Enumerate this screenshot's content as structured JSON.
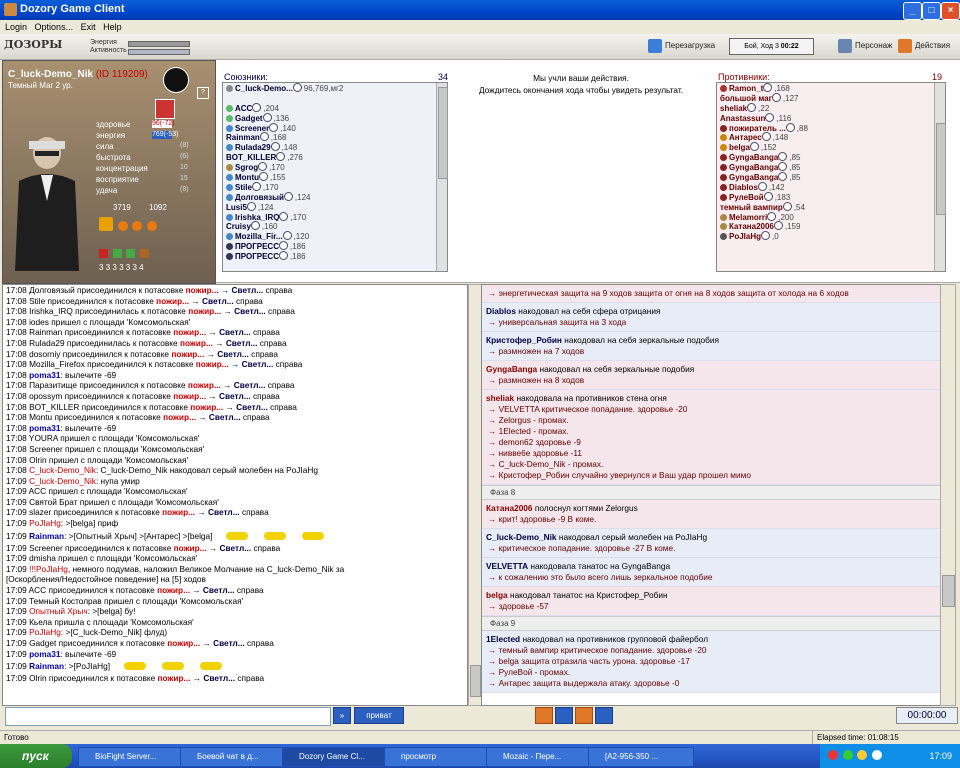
{
  "window": {
    "title": "Dozory Game Client"
  },
  "menu": [
    "Login",
    "Options...",
    "Exit",
    "Help"
  ],
  "toolbar": {
    "logo": "ДОЗОРЫ",
    "energy_label": "Энергия",
    "activity_label": "Активность",
    "reload_label": "Перезагрузка",
    "turn_label": "Бой, Ход 3",
    "turn_time": "00:22",
    "character_label": "Персонаж",
    "actions_label": "Действия"
  },
  "character": {
    "name": "C_luck-Demo_Nik",
    "id": "(ID 119209)",
    "rank": "Темный Маг 2 ур.",
    "stats": [
      {
        "label": "здоровье",
        "value": "96(-72)"
      },
      {
        "label": "энергия",
        "value": "769(-53)"
      },
      {
        "label": "сила",
        "value": "(8)"
      },
      {
        "label": "быстрота",
        "value": "(6)"
      },
      {
        "label": "концентрация",
        "value": "10"
      },
      {
        "label": "восприятие",
        "value": "15"
      },
      {
        "label": "удача",
        "value": "(8)"
      }
    ],
    "money1": "3719",
    "money2": "1092",
    "slots": [
      "3",
      "3",
      "3",
      "3",
      "3",
      "3",
      "4"
    ]
  },
  "allies": {
    "title": "Союзники:",
    "count": "34",
    "rows": [
      {
        "name": "C_luck-Demo...",
        "info": "96,769,мг2",
        "color": "#888"
      },
      {
        "name": "",
        "info": "",
        "color": ""
      },
      {
        "name": "ACC",
        "info": ",204",
        "color": "#5b6"
      },
      {
        "name": "Gadget",
        "info": ",136",
        "color": "#5b6"
      },
      {
        "name": "Screener",
        "info": ",140",
        "color": "#48c"
      },
      {
        "name": "Rainman",
        "info": ",168",
        "color": ""
      },
      {
        "name": "Rulada29",
        "info": ",148",
        "color": "#48c"
      },
      {
        "name": "BOT_KILLER",
        "info": ",276",
        "color": ""
      },
      {
        "name": "Sgrog",
        "info": ",170",
        "color": "#a84"
      },
      {
        "name": "Montu",
        "info": ",155",
        "color": "#48c"
      },
      {
        "name": "Stile",
        "info": ",170",
        "color": "#48c"
      },
      {
        "name": "Долговязый",
        "info": ",124",
        "color": "#48c"
      },
      {
        "name": "Lusi5",
        "info": ",124",
        "color": ""
      },
      {
        "name": "Irishka_IRQ",
        "info": ",170",
        "color": "#48c"
      },
      {
        "name": "Cruisy",
        "info": ",160",
        "color": ""
      },
      {
        "name": "Mozilla_Fir...",
        "info": ",120",
        "color": "#48c"
      },
      {
        "name": "ПРОГРЕСС",
        "info": ",186",
        "color": "#335"
      },
      {
        "name": "ПРОГРЕСС",
        "info": ",186",
        "color": "#335"
      }
    ]
  },
  "center_message": {
    "line1": "Мы учли ваши действия.",
    "line2": "Дождитесь окончания хода чтобы увидеть результат."
  },
  "enemies": {
    "title": "Противники:",
    "count": "19",
    "rows": [
      {
        "name": "Ramon_t",
        "info": ",168",
        "color": "#a33"
      },
      {
        "name": "большой маг",
        "info": ",127",
        "color": ""
      },
      {
        "name": "sheliak",
        "info": ",22",
        "color": ""
      },
      {
        "name": "Anastassun",
        "info": ",116",
        "color": ""
      },
      {
        "name": "пожиратель ...",
        "info": ",88",
        "color": "#822"
      },
      {
        "name": "Антарес",
        "info": ",148",
        "color": "#c80"
      },
      {
        "name": "belga",
        "info": ",152",
        "color": "#c80"
      },
      {
        "name": "GyngaBanga",
        "info": ",85",
        "color": "#822"
      },
      {
        "name": "GyngaBanga",
        "info": ",85",
        "color": "#822"
      },
      {
        "name": "GyngaBanga",
        "info": ",85",
        "color": "#822"
      },
      {
        "name": "Diablos",
        "info": ",142",
        "color": "#822"
      },
      {
        "name": "РулеВой",
        "info": ",183",
        "color": "#822"
      },
      {
        "name": "темный вампир",
        "info": ",54",
        "color": ""
      },
      {
        "name": "Melamorri",
        "info": ",200",
        "color": "#a84"
      },
      {
        "name": "Катана2006",
        "info": ",159",
        "color": "#a84"
      },
      {
        "name": "PoJIaHg",
        "info": ",0",
        "color": "#555"
      }
    ]
  },
  "chat": [
    {
      "t": "17:08",
      "txt": "Долговязый присоединился к потасовке",
      "pz": "пожир...",
      "sv": "Светл...",
      "end": "справа"
    },
    {
      "t": "17:08",
      "txt": "Stile присоединился к потасовке",
      "pz": "пожир...",
      "sv": "Светл...",
      "end": "справа"
    },
    {
      "t": "17:08",
      "txt": "Irishka_IRQ присоединилась к потасовке",
      "pz": "пожир...",
      "sv": "Светл...",
      "end": "справа"
    },
    {
      "t": "17:08",
      "txt": "iodes пришел с площади 'Комсомольская'"
    },
    {
      "t": "17:08",
      "txt": "Rainman присоединился к потасовке",
      "pz": "пожир...",
      "sv": "Светл...",
      "end": "справа"
    },
    {
      "t": "17:08",
      "txt": "Rulada29 присоединилась к потасовке",
      "pz": "пожир...",
      "sv": "Светл...",
      "end": "справа"
    },
    {
      "t": "17:08",
      "txt": "dosorniy присоединился к потасовке",
      "pz": "пожир...",
      "sv": "Светл...",
      "end": "справа"
    },
    {
      "t": "17:08",
      "txt": "Mozilla_Firefox присоединился к потасовке",
      "pz": "пожир...",
      "sv": "Светл...",
      "end": "справа"
    },
    {
      "t": "17:08",
      "bl": "poma31",
      "txt": ": вылечите -69"
    },
    {
      "t": "17:08",
      "txt": "Паразитище присоединился к потасовке",
      "pz": "пожир...",
      "sv": "Светл...",
      "end": "справа"
    },
    {
      "t": "17:08",
      "txt": "opossym присоединился к потасовке",
      "pz": "пожир...",
      "sv": "Светл...",
      "end": "справа"
    },
    {
      "t": "17:08",
      "txt": "BOT_KILLER присоединился к потасовке",
      "pz": "пожир...",
      "sv": "Светл...",
      "end": "справа"
    },
    {
      "t": "17:08",
      "txt": "Montu присоединился к потасовке",
      "pz": "пожир...",
      "sv": "Светл...",
      "end": "справа"
    },
    {
      "t": "17:08",
      "bl": "poma31",
      "txt": ": вылечите -69"
    },
    {
      "t": "17:08",
      "txt": "YOURA пришел с площади 'Комсомольская'"
    },
    {
      "t": "17:08",
      "txt": "Screener пришел с площади 'Комсомольская'"
    },
    {
      "t": "17:08",
      "txt": "Olrin пришел с площади 'Комсомольская'"
    },
    {
      "t": "17:08",
      "red": "C_luck-Demo_Nik",
      "txt": ": C_luck-Demo_Nik накoдовал серый молебен на PoJIaHg"
    },
    {
      "t": "17:09",
      "red": "C_luck-Demo_Nik",
      "txt": ": нупа умир"
    },
    {
      "t": "17:09",
      "txt": "ACC пришел с площади 'Комсомольская'"
    },
    {
      "t": "17:09",
      "txt": "Святой Брат пришел с площади 'Комсомольская'"
    },
    {
      "t": "17:09",
      "txt": "slazer присоединился к потасовке",
      "pz": "пожир...",
      "sv": "Светл...",
      "end": "справа"
    },
    {
      "t": "17:09",
      "red": "PoJIaHg",
      "txt": ": >[belga] приф"
    },
    {
      "t": "17:09",
      "bl": "Rainman",
      "txt": ": >[Опытный Хрыч] >[Антарес] >[belga]",
      "tall": true
    },
    {
      "t": "17:09",
      "txt": "Screener присоединился к потасовке",
      "pz": "пожир...",
      "sv": "Светл...",
      "end": "справа"
    },
    {
      "t": "17:09",
      "txt": "dmisha пришел с площади 'Комсомольская'"
    },
    {
      "t": "17:09",
      "red": "!!!PoJIaHg",
      "txt": ", немного подумав, наложил Великое Молчание на C_luck-Demo_Nik за"
    },
    {
      "t": "",
      "txt": "[Оскорбления/Недостойное поведение] на [5] ходов"
    },
    {
      "t": "17:09",
      "txt": "ACC присоединился к потасовке",
      "pz": "пожир...",
      "sv": "Светл...",
      "end": "справа"
    },
    {
      "t": "17:09",
      "txt": "Темный Костолрав пришел с площади 'Комсомольская'"
    },
    {
      "t": "17:09",
      "red": "Опытный Хрыч",
      "txt": ": >[belga] бу!"
    },
    {
      "t": "17:09",
      "txt": "Кьела пришла с площади 'Комсомольская'"
    },
    {
      "t": "17:09",
      "red": "PoJIaHg",
      "txt": ": >[C_luck-Demo_Nik] флуд)"
    },
    {
      "t": "17:09",
      "txt": "Gadget присоединился к потасовке",
      "pz": "пожир...",
      "sv": "Светл...",
      "end": "справа"
    },
    {
      "t": "17:09",
      "bl": "poma31",
      "txt": ": вылечите -69"
    },
    {
      "t": "17:09",
      "bl": "Rainman",
      "txt": ": >[PoJIaHg]",
      "tall": true
    },
    {
      "t": "17:09",
      "txt": "Olrin присоединился к потасовке",
      "pz": "пожир...",
      "sv": "Светл...",
      "end": "справа"
    }
  ],
  "battle": [
    {
      "kind": "p",
      "act": "",
      "text": "",
      "subs": [
        "→ энергетическая защита на 9 ходов защита от огня на 8 ходов защита от холода на 6 ходов"
      ]
    },
    {
      "kind": "b",
      "act": "Diablos",
      "text": "накoдовал на себя сферa отрицания",
      "subs": [
        "→ универсальная защита на 3 хода"
      ]
    },
    {
      "kind": "b",
      "act": "Кристофер_Робин",
      "text": "накoдовал на себя зеркальные подобия",
      "subs": [
        "→ размножен на 7 ходов"
      ]
    },
    {
      "kind": "p",
      "act": "GyngaBanga",
      "text": "накoдовал на себя зеркальные подобия",
      "subs": [
        "→ размножен на 8 ходов"
      ]
    },
    {
      "kind": "p",
      "act": "sheliak",
      "text": "накoдовала на противников стена огня",
      "subs": [
        "→ VELVETTA критическое попадание. здоровье -20",
        "→ Zelorgus - промах.",
        "→ 1Elected - промах.",
        "→ demon62 здоровье -9",
        "→ нивве6е здоровье -11",
        "→ C_luck-Demo_Nik - промах.",
        "→ Кристофер_Робин случайно увернулся и Ваш удар прошел мимо"
      ]
    },
    {
      "kind": "phase",
      "text": "Фаза 8"
    },
    {
      "kind": "p",
      "act": "Катана2006",
      "text": "полоснул когтями Zelorgus",
      "subs": [
        "→ крит! здоровье -9 В коме."
      ]
    },
    {
      "kind": "b",
      "act": "C_luck-Demo_Nik",
      "text": "накoдовал серый молебен на PoJIaHg",
      "subs": [
        "→ критическое попадание. здоровье -27 В коме."
      ]
    },
    {
      "kind": "b",
      "act": "VELVETTA",
      "text": "накoдовала танатос на GyngaBanga",
      "subs": [
        "→ к сожалению это было всего лишь зеркальное подобие"
      ]
    },
    {
      "kind": "p",
      "act": "belga",
      "text": "накoдовал танатос на Кристофер_Робин",
      "subs": [
        "→ здоровье -57"
      ]
    },
    {
      "kind": "phase",
      "text": "Фаза 9"
    },
    {
      "kind": "b",
      "act": "1Elected",
      "text": "накoдовал на противников групповой файербол",
      "subs": [
        "→ темный вампир критическое попадание. здоровье -20",
        "→ belga защита отразила часть урона. здоровье -17",
        "→ РулеВой - промах.",
        "→ Антарес защита выдержала атаку. здоровье -0"
      ]
    }
  ],
  "bottom": {
    "send_label": "привaт",
    "timer": "00:00:00"
  },
  "status": {
    "left": "Готово",
    "elapsed": "Elapsed time: 01:08:15"
  },
  "taskbar": {
    "start": "пуск",
    "tasks": [
      "BioFight Server...",
      "Боевой чат в д...",
      "Dozory Game Cl...",
      "просмотр",
      "Mozaic - Пере...",
      "[A2-956-350 ..."
    ],
    "clock": "17:09"
  }
}
